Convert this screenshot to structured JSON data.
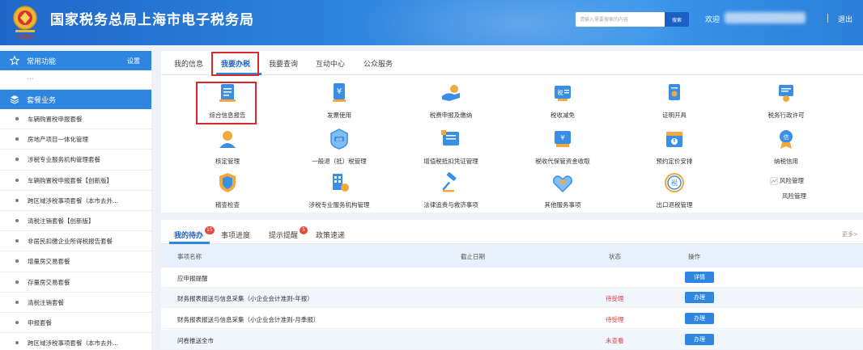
{
  "header": {
    "title": "国家税务总局上海市电子税务局",
    "search_placeholder": "请输入需要搜索的内容",
    "search_button": "搜索",
    "welcome": "欢迎",
    "logout": "退出",
    "emblem_text": "中国税务",
    "bg_color": "#2f86e0"
  },
  "sidebar": {
    "common_functions": "常用功能",
    "settings": "设置",
    "placeholder": "...",
    "package_business": "套餐业务",
    "items": [
      "车辆购置税申报套餐",
      "房地产项目一体化管理",
      "涉税专业服务机构管理套餐",
      "车辆购置税申报套餐【创新版】",
      "跨区域涉税事项套餐（本市去外...",
      "清税注销套餐【创新版】",
      "非居民扣缴企业所得税报告套餐",
      "增量房交易套餐",
      "存量房交易套餐",
      "清税注销套餐",
      "申报套餐",
      "跨区域涉税事项套餐（本市去外..."
    ]
  },
  "top_tabs": [
    "我的信息",
    "我要办税",
    "我要查询",
    "互动中心",
    "公众服务"
  ],
  "services": [
    {
      "label": "综合信息报告",
      "icon": "report-icon"
    },
    {
      "label": "发票使用",
      "icon": "invoice-icon"
    },
    {
      "label": "税费申报及缴纳",
      "icon": "tax-payment-icon"
    },
    {
      "label": "税收减免",
      "icon": "tax-reduction-icon"
    },
    {
      "label": "证明开具",
      "icon": "certificate-icon"
    },
    {
      "label": "税务行政许可",
      "icon": "license-icon"
    },
    {
      "label": "核定管理",
      "icon": "verification-icon"
    },
    {
      "label": "一般退（抵）税管理",
      "icon": "refund-icon"
    },
    {
      "label": "增值税抵扣凭证管理",
      "icon": "vat-voucher-icon"
    },
    {
      "label": "税收代保管资金收取",
      "icon": "custody-funds-icon"
    },
    {
      "label": "预约定价安排",
      "icon": "pricing-calendar-icon"
    },
    {
      "label": "纳税信用",
      "icon": "credit-icon"
    },
    {
      "label": "稽查检查",
      "icon": "inspection-icon"
    },
    {
      "label": "涉税专业服务机构管理",
      "icon": "agency-management-icon"
    },
    {
      "label": "法律追责与救济事项",
      "icon": "legal-gavel-icon"
    },
    {
      "label": "其他服务事项",
      "icon": "other-services-icon"
    },
    {
      "label": "出口退税管理",
      "icon": "export-refund-icon"
    },
    {
      "label": "风险管理",
      "icon": "risk-management-icon",
      "broken_image_alt": "风险管理"
    }
  ],
  "bottom_tabs": [
    {
      "label": "我的待办",
      "badge": "15"
    },
    {
      "label": "事项进度",
      "badge": ""
    },
    {
      "label": "提示提醒",
      "badge": "5"
    },
    {
      "label": "政策速递",
      "badge": ""
    }
  ],
  "more": "更多>",
  "table": {
    "headers": [
      "事项名称",
      "截止日期",
      "状态",
      "操作"
    ],
    "rows": [
      {
        "name": "应申报提醒",
        "deadline": "",
        "status": "",
        "action": "详情"
      },
      {
        "name": "财务报表报送与信息采集（小企业会计准则-年报）",
        "deadline": "",
        "status": "待受理",
        "action": "办理"
      },
      {
        "name": "财务报表报送与信息采集（小企业会计准则-月季报）",
        "deadline": "",
        "status": "待受理",
        "action": "办理"
      },
      {
        "name": "问卷推送全市",
        "deadline": "",
        "status": "未查看",
        "action": "办理"
      }
    ]
  }
}
